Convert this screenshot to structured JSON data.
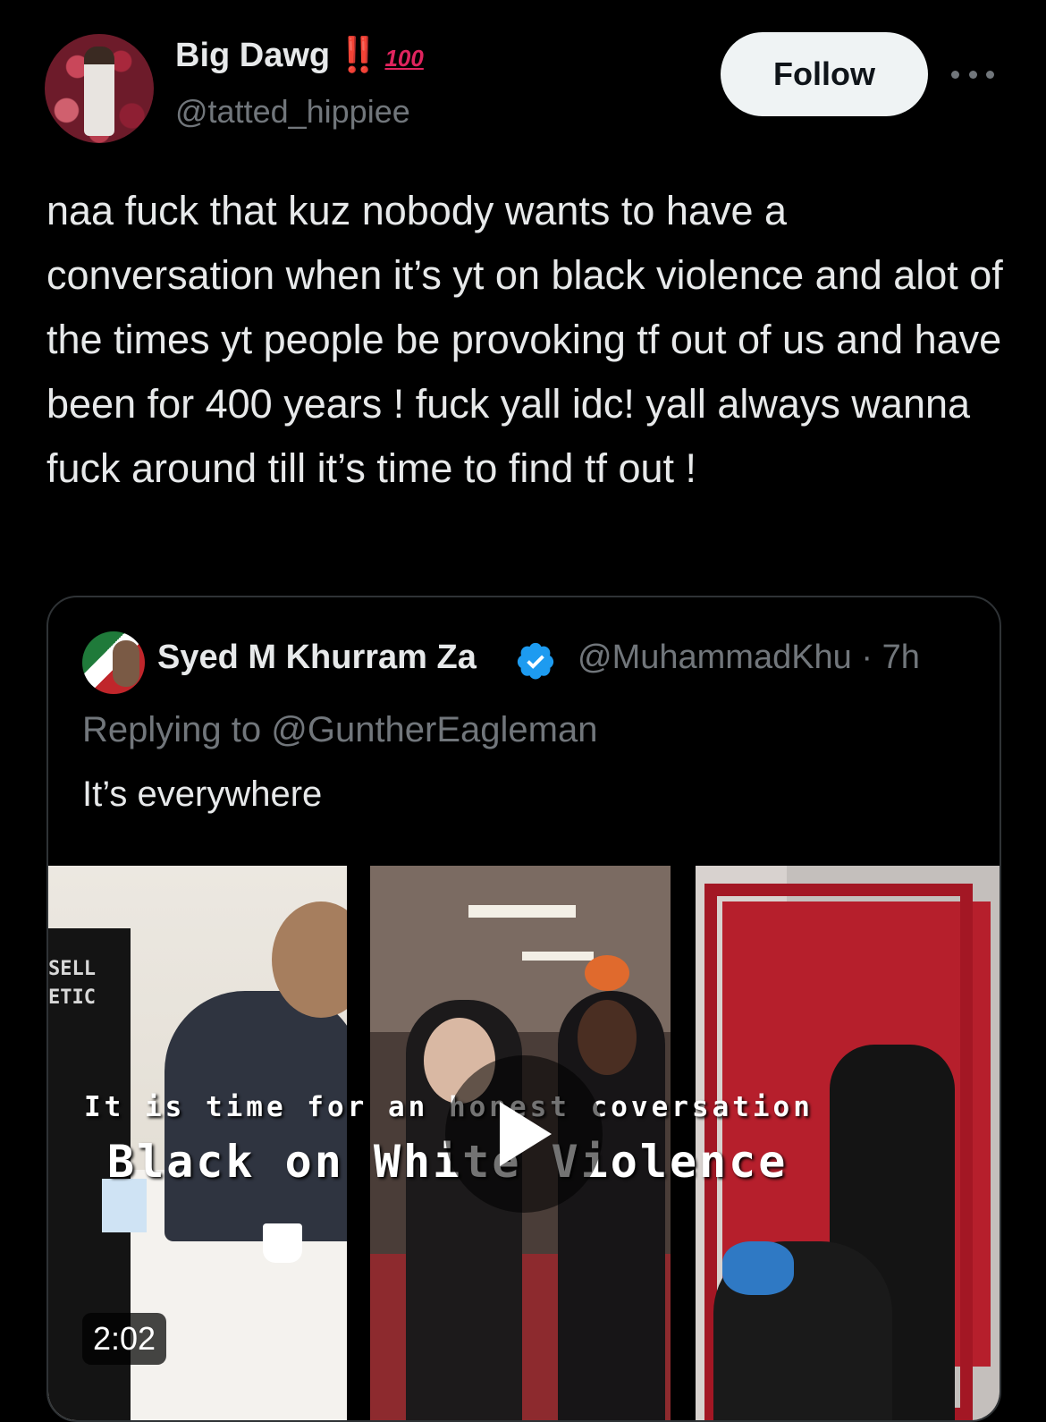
{
  "tweet": {
    "display_name": "Big Dawg",
    "name_emoji_1": "‼️",
    "name_emoji_2": "100",
    "handle": "@tatted_hippiee",
    "follow_label": "Follow",
    "text": "naa fuck that kuz nobody wants to have a conversation when it’s yt on black violence and alot of the times yt people be provoking tf out of us and have been for 400 years ! fuck yall idc! yall always wanna fuck around till it’s time to find tf out !"
  },
  "quote": {
    "display_name": "Syed M Khurram Za",
    "handle_time": "@MuhammadKhu · 7h",
    "replying_to": "Replying to @GuntherEagleman",
    "text": "It’s everywhere",
    "video": {
      "caption_line1": "It is time for an honest coversation",
      "caption_line2": "Black on White Violence",
      "hoodie_text_1": "SELL",
      "hoodie_text_2": "ETIC",
      "duration": "2:02"
    }
  },
  "icons": {
    "more": "more-horizontal-icon",
    "verified": "verified-badge-icon",
    "play": "play-icon"
  },
  "colors": {
    "background": "#000000",
    "text": "#e7e9ea",
    "secondary": "#71767b",
    "verified_blue": "#1d9bf0",
    "follow_bg": "#eff3f4",
    "border": "#2f3336"
  }
}
